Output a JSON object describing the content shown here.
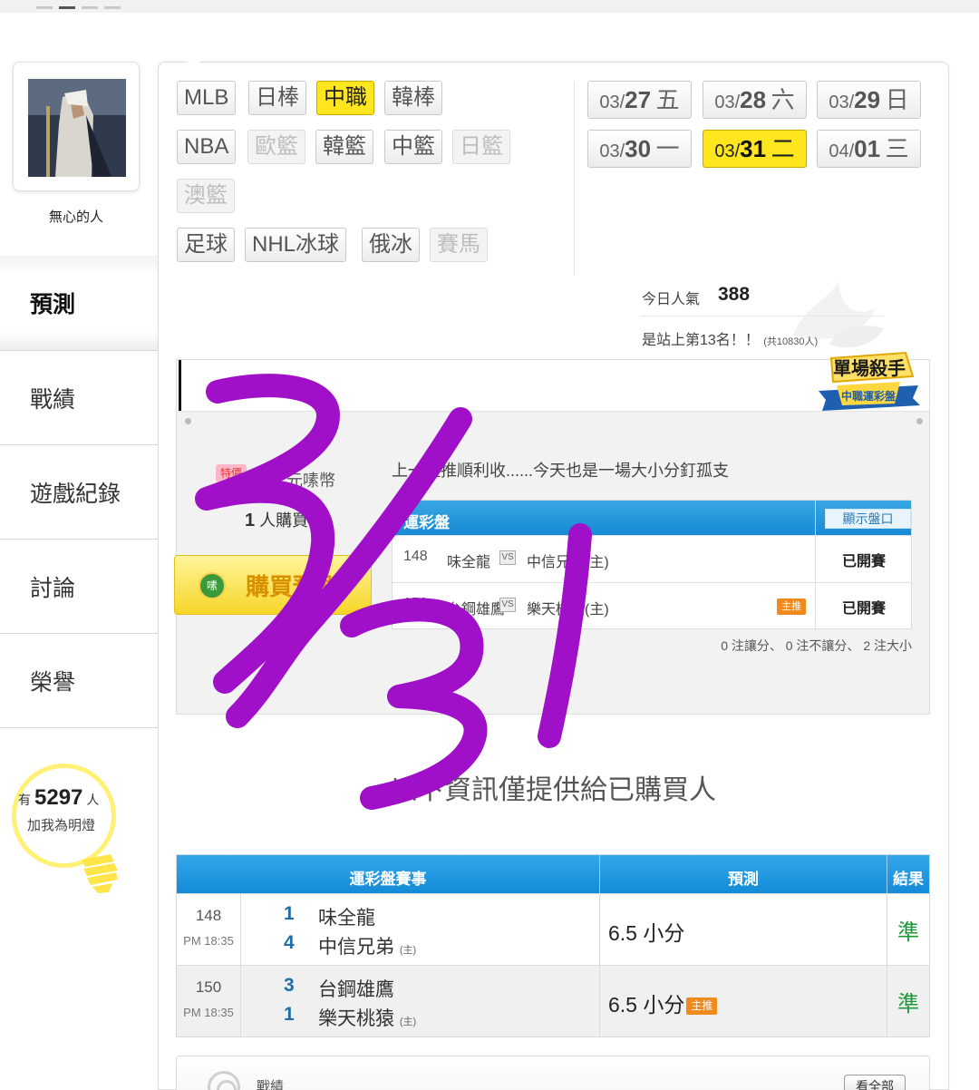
{
  "sidebar": {
    "username": "無心的人",
    "menu": [
      {
        "label": "預測",
        "active": true
      },
      {
        "label": "戰績"
      },
      {
        "label": "遊戲紀錄"
      },
      {
        "label": "討論"
      },
      {
        "label": "榮譽"
      }
    ],
    "fans": {
      "prefix": "有",
      "count": "5297",
      "suffix": "人",
      "cta": "加我為明燈"
    }
  },
  "leagues": [
    {
      "label": "MLB"
    },
    {
      "label": "日棒"
    },
    {
      "label": "中職",
      "selected": true
    },
    {
      "label": "韓棒"
    },
    {
      "label": "NBA"
    },
    {
      "label": "歐籃",
      "disabled": true
    },
    {
      "label": "韓籃"
    },
    {
      "label": "中籃"
    },
    {
      "label": "日籃",
      "disabled": true
    },
    {
      "label": "澳籃",
      "disabled": true
    },
    {
      "label": "足球"
    },
    {
      "label": "NHL冰球"
    },
    {
      "label": "俄冰"
    },
    {
      "label": "賽馬",
      "disabled": true
    }
  ],
  "dates": [
    {
      "md_prefix": "03/",
      "day": "27",
      "weekday": "五"
    },
    {
      "md_prefix": "03/",
      "day": "28",
      "weekday": "六"
    },
    {
      "md_prefix": "03/",
      "day": "29",
      "weekday": "日"
    },
    {
      "md_prefix": "03/",
      "day": "30",
      "weekday": "一"
    },
    {
      "md_prefix": "03/",
      "day": "31",
      "weekday": "二",
      "selected": true
    },
    {
      "md_prefix": "04/",
      "day": "01",
      "weekday": "三"
    }
  ],
  "popularity": {
    "label": "今日人氣",
    "value": "388",
    "rank_text": "是站上第13名！！",
    "total_text": "(共10830人)"
  },
  "single_game": {
    "badge_title": "單場殺手",
    "badge_subtitle": "中職運彩盤",
    "price_tag": "特價",
    "price_text": "元嗉幣",
    "buyers_count": "1",
    "buyers_label": "人購買",
    "buy_button": "購買預測",
    "buy_logo": "嗉",
    "description": "上一注推順利收......今天也是一場大小分釘孤支",
    "table_title": "運彩盤",
    "show_odds": "顯示盤口",
    "games": [
      {
        "num": "148",
        "away": "味全龍",
        "vs": "VS",
        "home": "中信兄弟(主)",
        "status": "已開賽",
        "main": ""
      },
      {
        "num": "150",
        "away": "台鋼雄鷹",
        "vs": "VS",
        "home": "樂天桃猿(主)",
        "status": "已開賽",
        "main": "主推"
      }
    ],
    "summary": "0 注讓分、 0 注不讓分、 2 注大小"
  },
  "info_note": "以下資訊僅提供給已購買人",
  "predictions": {
    "headers": [
      "運彩盤賽事",
      "預測",
      "結果"
    ],
    "rows": [
      {
        "num": "148",
        "time": "PM 18:35",
        "away_score": "1",
        "away": "味全龍",
        "home_score": "4",
        "home": "中信兄弟",
        "home_tag": "(主)",
        "pred": "6.5 小分",
        "main": "",
        "result": "準"
      },
      {
        "num": "150",
        "time": "PM 18:35",
        "away_score": "3",
        "away": "台鋼雄鷹",
        "home_score": "1",
        "home": "樂天桃猿",
        "home_tag": "(主)",
        "pred": "6.5 小分",
        "main": "主推",
        "result": "準"
      }
    ]
  },
  "record_box": {
    "title": "戰績",
    "button": "看全部"
  },
  "colors": {
    "selected": "#ffe61f",
    "table_header": "#168ad4",
    "result_green": "#1c9a3a",
    "main_tag": "#f08a1c",
    "annotation": "#a010c8"
  }
}
